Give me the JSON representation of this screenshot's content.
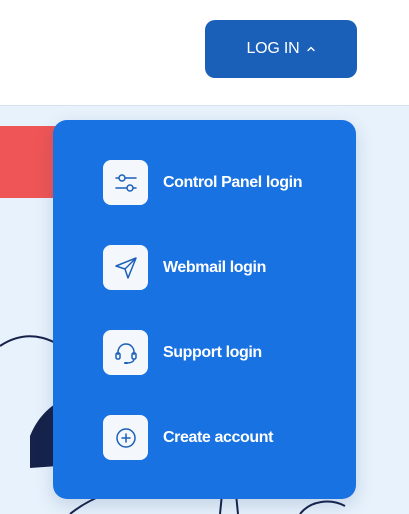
{
  "header": {
    "login_label": "LOG IN",
    "login_chevron_icon": "chevron-up-icon"
  },
  "colors": {
    "login_button": "#1a60b8",
    "dropdown_background": "#1872e2",
    "hero_background": "#e8f2fc",
    "banner": "#ef5556",
    "icon_tile": "#f4f8fd",
    "icon_stroke": "#1a60b8"
  },
  "login_menu": {
    "items": [
      {
        "label": "Control Panel login",
        "icon": "sliders-icon"
      },
      {
        "label": "Webmail login",
        "icon": "paper-plane-icon"
      },
      {
        "label": "Support login",
        "icon": "headset-icon"
      },
      {
        "label": "Create account",
        "icon": "plus-circle-icon"
      }
    ]
  }
}
